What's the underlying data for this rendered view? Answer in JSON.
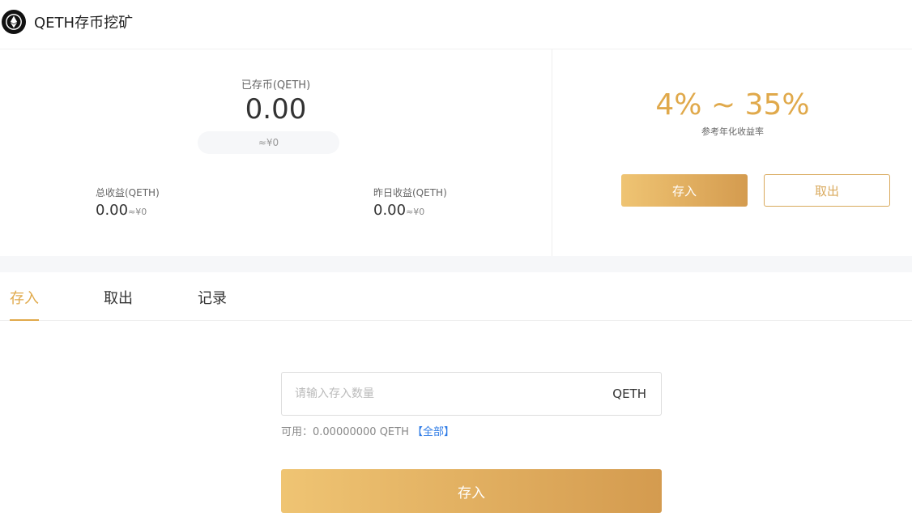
{
  "header": {
    "logo_icon": "ethereum-icon",
    "title": "QETH存币挖矿"
  },
  "summary": {
    "deposited_label": "已存币(QETH)",
    "deposited_value": "0.00",
    "deposited_cny": "≈¥0",
    "total_income_label": "总收益(QETH)",
    "total_income_value": "0.00",
    "total_income_cny": "≈¥0",
    "yesterday_income_label": "昨日收益(QETH)",
    "yesterday_income_value": "0.00",
    "yesterday_income_cny": "≈¥0"
  },
  "rate": {
    "value": "4% ~ 35%",
    "label": "参考年化收益率",
    "deposit_button": "存入",
    "withdraw_button": "取出"
  },
  "tabs": [
    {
      "label": "存入",
      "active": true
    },
    {
      "label": "取出",
      "active": false
    },
    {
      "label": "记录",
      "active": false
    }
  ],
  "form": {
    "amount_placeholder": "请输入存入数量",
    "unit": "QETH",
    "available_text": "可用：0.00000000 QETH",
    "all_link": "【全部】",
    "submit_button": "存入"
  },
  "colors": {
    "accent": "#e0a94b",
    "link": "#2e7be6"
  }
}
